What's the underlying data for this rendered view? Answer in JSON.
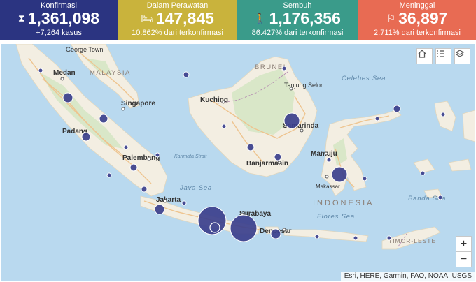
{
  "stats": [
    {
      "title": "Konfirmasi",
      "value": "1,361,098",
      "sub": "+7,264 kasus",
      "color": "#2b3481",
      "icon": "hourglass-icon"
    },
    {
      "title": "Dalam Perawatan",
      "value": "147,845",
      "sub": "10.862% dari terkonfirmasi",
      "color": "#c9b33c",
      "icon": "bed-icon"
    },
    {
      "title": "Sembuh",
      "value": "1,176,356",
      "sub": "86.427% dari terkonfirmasi",
      "color": "#3a9b8a",
      "icon": "walking-person-icon"
    },
    {
      "title": "Meninggal",
      "value": "36,897",
      "sub": "2.711% dari terkonfirmasi",
      "color": "#e86b53",
      "icon": "fallen-person-icon"
    }
  ],
  "map": {
    "labels": {
      "george_town": "George Town",
      "malaysia": "MALAYSIA",
      "medan": "Medan",
      "brunei": "BRUNEI",
      "tanjung_selor": "Tanjung Selor",
      "celebes_sea": "Celebes Sea",
      "kuching": "Kuching",
      "singapore": "Singapore",
      "padang": "Padang",
      "samarinda": "Samarinda",
      "karimata": "Karimata Strait",
      "palembang": "Palembang",
      "mamuju": "Mamuju",
      "banjarmasin": "Banjarmasin",
      "java_sea": "Java Sea",
      "makassar": "Makassar",
      "indonesia": "INDONESIA",
      "banda_sea": "Banda Sea",
      "jakarta": "Jakarta",
      "surabaya": "Surabaya",
      "flores_sea": "Flores Sea",
      "denpasar": "Denpasar",
      "timor_leste": "TIMOR-LESTE"
    },
    "attribution": "Esri, HERE, Garmin, FAO, NOAA, USGS",
    "zoom_in": "+",
    "zoom_out": "−",
    "marker_color": "#3b3f8c"
  }
}
